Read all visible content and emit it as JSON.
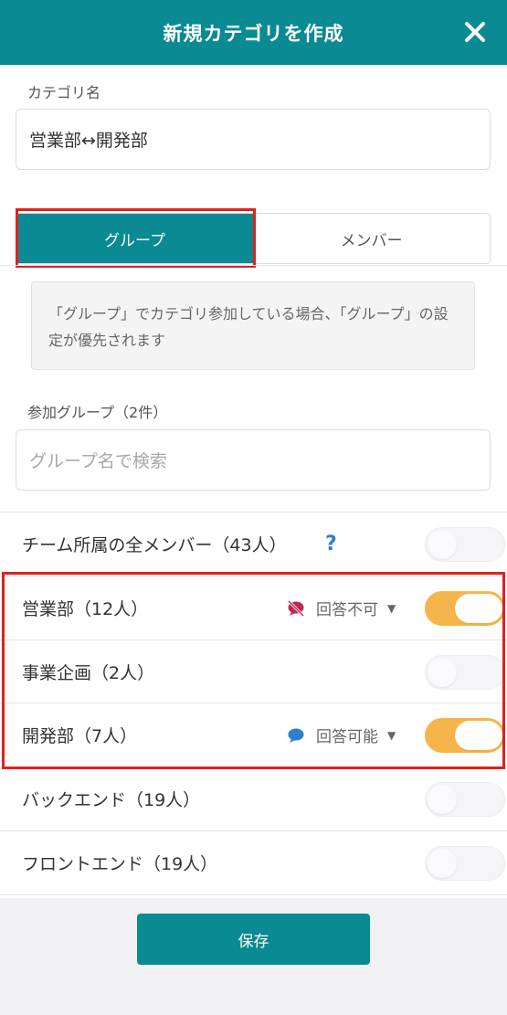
{
  "header": {
    "title": "新規カテゴリを作成",
    "close_icon": "close-icon"
  },
  "category": {
    "label": "カテゴリ名",
    "value": "営業部↔開発部"
  },
  "tabs": [
    {
      "label": "グループ",
      "active": true
    },
    {
      "label": "メンバー",
      "active": false
    }
  ],
  "notice": "「グループ」でカテゴリ参加している場合、「グループ」の設定が優先されます",
  "groups": {
    "label": "参加グループ（2件）",
    "search_placeholder": "グループ名で検索"
  },
  "all_members": {
    "label": "チーム所属の全メンバー（43人）",
    "help": "?",
    "enabled": false
  },
  "rows": [
    {
      "label": "営業部（12人）",
      "status": "回答不可",
      "status_icon": "no-reply-icon",
      "enabled": true
    },
    {
      "label": "事業企画（2人）",
      "enabled": false
    },
    {
      "label": "開発部（7人）",
      "status": "回答可能",
      "status_icon": "reply-icon",
      "enabled": true
    },
    {
      "label": "バックエンド（19人）",
      "enabled": false
    },
    {
      "label": "フロントエンド（19人）",
      "enabled": false
    }
  ],
  "footer": {
    "save_label": "保存"
  },
  "colors": {
    "primary": "#0a8a92",
    "toggle_on": "#f6b54a",
    "highlight": "#e02020",
    "no_reply": "#c0294f",
    "reply": "#2d7fc9"
  }
}
